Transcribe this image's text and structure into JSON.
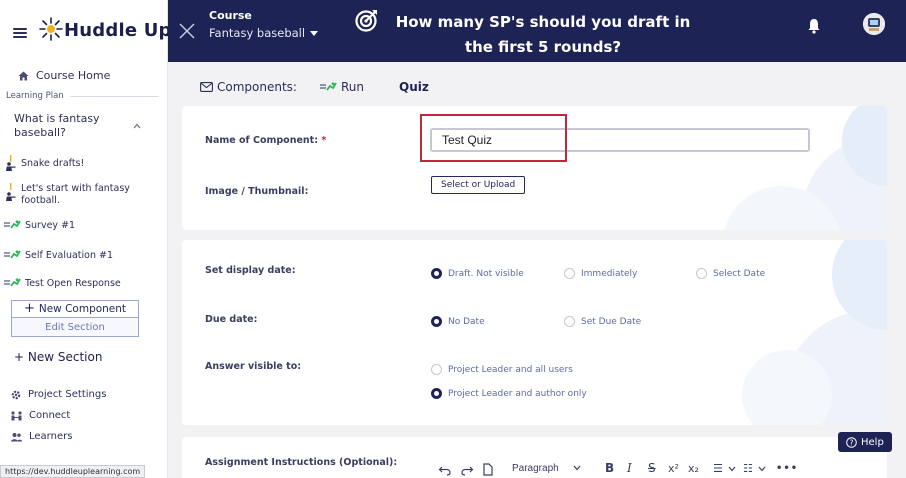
{
  "brand": {
    "logo_text": "Huddle Up"
  },
  "header": {
    "course_label": "Course",
    "course_name": "Fantasy baseball",
    "title": "How many SP's should you draft in the first 5 rounds?"
  },
  "sidebar": {
    "course_home": "Course Home",
    "learning_plan": "Learning Plan",
    "section_title": "What is fantasy baseball?",
    "items": [
      {
        "label": "Snake drafts!",
        "icon": "teacher-icon"
      },
      {
        "label": "Let's start with fantasy football.",
        "icon": "teacher-icon"
      },
      {
        "label": "Survey #1",
        "icon": "run-icon"
      },
      {
        "label": "Self Evaluation #1",
        "icon": "run-icon"
      },
      {
        "label": "Test Open Response",
        "icon": "run-icon"
      }
    ],
    "new_component": "New Component",
    "edit_section": "Edit Section",
    "new_section": "+ New Section",
    "project_settings": "Project Settings",
    "connect": "Connect",
    "learners": "Learners"
  },
  "status_url": "https://dev.huddleuplearning.com",
  "tabs": {
    "components": "Components:",
    "run": "Run",
    "quiz": "Quiz"
  },
  "form": {
    "name_label": "Name of Component:",
    "required_mark": "*",
    "name_value": "Test Quiz",
    "image_label": "Image / Thumbnail:",
    "upload_button": "Select or Upload",
    "display_date_label": "Set display date:",
    "display_options": [
      "Draft. Not visible",
      "Immediately",
      "Select Date"
    ],
    "display_selected": "Draft. Not visible",
    "due_date_label": "Due date:",
    "due_options": [
      "No Date",
      "Set Due Date"
    ],
    "due_selected": "No Date",
    "answer_visible_label": "Answer visible to:",
    "answer_options": [
      "Project Leader and all users",
      "Project Leader and author only"
    ],
    "answer_selected": "Project Leader and author only",
    "instructions_label": "Assignment Instructions (Optional):"
  },
  "editor": {
    "block_format": "Paragraph"
  },
  "help_button": "Help",
  "colors": {
    "navy": "#1e2356",
    "accent_green": "#2fb55a",
    "highlight_red": "#c0283d",
    "radio_text": "#5f6aa6"
  }
}
